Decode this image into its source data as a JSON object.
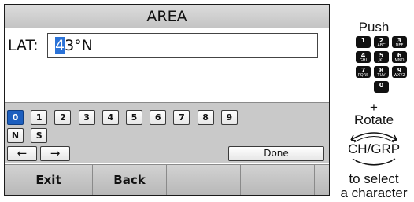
{
  "screen": {
    "title": "AREA",
    "field_label": "LAT:",
    "entry": {
      "cursor_char": "4",
      "rest": "3°N"
    },
    "keys_row1": [
      "0",
      "1",
      "2",
      "3",
      "4",
      "5",
      "6",
      "7",
      "8",
      "9"
    ],
    "selected_key": "0",
    "keys_row2": [
      "N",
      "S"
    ],
    "arrow_left": "←",
    "arrow_right": "→",
    "done_label": "Done",
    "softkeys": [
      "Exit",
      "Back",
      "",
      ""
    ]
  },
  "instructions": {
    "push": "Push",
    "keypad": [
      {
        "num": "1",
        "sub": ""
      },
      {
        "num": "2",
        "sub": "ABC"
      },
      {
        "num": "3",
        "sub": "DEF"
      },
      {
        "num": "4",
        "sub": "GHI"
      },
      {
        "num": "5",
        "sub": "JKL"
      },
      {
        "num": "6",
        "sub": "MNO"
      },
      {
        "num": "7",
        "sub": "PQRS"
      },
      {
        "num": "8",
        "sub": "TUV"
      },
      {
        "num": "9",
        "sub": "WXYZ"
      },
      {
        "num": "0",
        "sub": ""
      }
    ],
    "plus": "+",
    "rotate": "Rotate",
    "dial_label": "CH/GRP",
    "to_select_1": "to select",
    "to_select_2": "a character"
  },
  "colors": {
    "selection": "#1d5fbf",
    "cursor": "#2b73d8"
  }
}
